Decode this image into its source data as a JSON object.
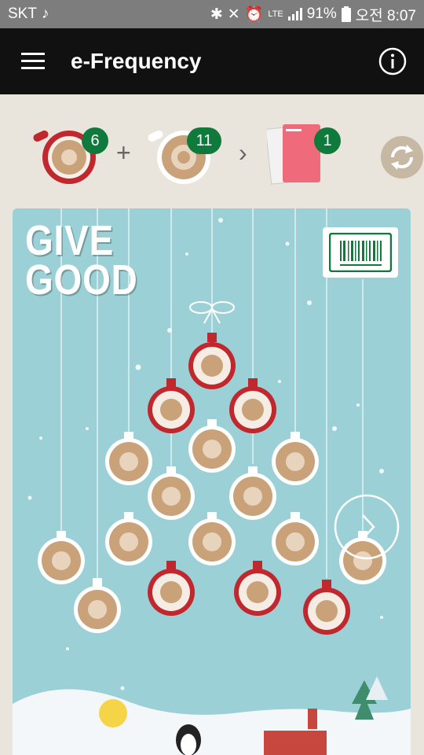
{
  "status_bar": {
    "carrier": "SKT",
    "battery": "91%",
    "time": "오전 8:07",
    "icons": [
      "music-note-icon",
      "bluetooth-icon",
      "mute-icon",
      "alarm-icon",
      "lte-icon",
      "signal-icon",
      "battery-icon"
    ]
  },
  "app_bar": {
    "title": "e-Frequency",
    "menu_icon": "hamburger-menu-icon",
    "info_icon": "info-icon"
  },
  "counters": {
    "red_cup_count": "6",
    "white_cup_count": "11",
    "planner_count": "1",
    "plus": "+",
    "arrow": "›",
    "refresh_icon": "refresh-icon"
  },
  "card": {
    "headline_line1": "GIVE",
    "headline_line2": "GOOD",
    "barcode_icon": "barcode-icon",
    "next_icon": "chevron-right-icon",
    "ornaments_total": 17,
    "ornaments_red": 6,
    "ornaments_white": 11
  },
  "colors": {
    "status_bar": "#7d7d7d",
    "app_bar": "#111111",
    "background": "#e9e4dc",
    "card_bg": "#9ad0d6",
    "badge_green": "#0f7a3c",
    "ornament_red": "#c0282e",
    "coffee": "#c9a27a"
  }
}
